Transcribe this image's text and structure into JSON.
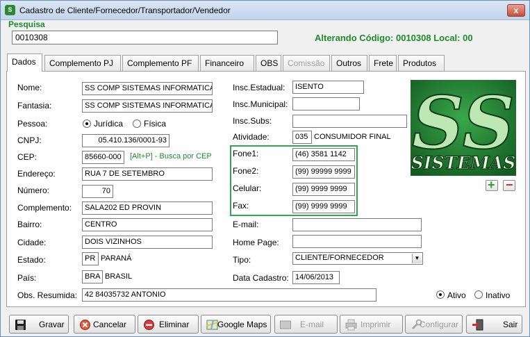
{
  "window": {
    "title": "Cadastro de Cliente/Fornecedor/Transportador/Vendedor",
    "close_glyph": "x"
  },
  "search": {
    "group_label": "Pesquisa",
    "value": "0010308"
  },
  "status": {
    "text": "Alterando Código: 0010308  Local: 00"
  },
  "tabs": [
    {
      "label": "Dados",
      "state": "active"
    },
    {
      "label": "Complemento PJ",
      "state": "normal"
    },
    {
      "label": "Complemento PF",
      "state": "normal"
    },
    {
      "label": "Financeiro",
      "state": "normal"
    },
    {
      "label": "OBS",
      "state": "normal"
    },
    {
      "label": "Comissão",
      "state": "disabled"
    },
    {
      "label": "Outros",
      "state": "normal"
    },
    {
      "label": "Frete",
      "state": "normal"
    },
    {
      "label": "Produtos",
      "state": "normal"
    }
  ],
  "form": {
    "nome": {
      "label": "Nome:",
      "value": "SS COMP SISTEMAS INFORMATICA"
    },
    "fantasia": {
      "label": "Fantasia:",
      "value": "SS COMP SISTEMAS INFORMATICA"
    },
    "pessoa": {
      "label": "Pessoa:",
      "options": [
        "Jurídica",
        "Física"
      ],
      "selected": "Jurídica"
    },
    "cnpj": {
      "label": "CNPJ:",
      "value": "05.410.136/0001-93"
    },
    "cep": {
      "label": "CEP:",
      "value": "85660-000",
      "hint": "[Alt+P]  - Busca por CEP"
    },
    "endereco": {
      "label": "Endereço:",
      "value": "RUA 7 DE SETEMBRO"
    },
    "numero": {
      "label": "Número:",
      "value": "70"
    },
    "complemento": {
      "label": "Complemento:",
      "value": "SALA202 ED PROVIN"
    },
    "bairro": {
      "label": "Bairro:",
      "value": "CENTRO"
    },
    "cidade": {
      "label": "Cidade:",
      "value": "DOIS VIZINHOS"
    },
    "estado": {
      "label": "Estado:",
      "code": "PR",
      "name": "PARANÁ"
    },
    "pais": {
      "label": "País:",
      "code": "BRA",
      "name": "BRASIL"
    },
    "obs_resumida": {
      "label": "Obs. Resumida:",
      "value": "42 84035732 ANTONIO"
    },
    "insc_estadual": {
      "label": "Insc.Estadual:",
      "value": "ISENTO"
    },
    "insc_municipal": {
      "label": "Insc.Municipal:",
      "value": ""
    },
    "insc_subs": {
      "label": "Insc.Subs:",
      "value": ""
    },
    "atividade": {
      "label": "Atividade:",
      "code": "035",
      "name": "CONSUMIDOR FINAL"
    },
    "fone1": {
      "label": "Fone1:",
      "value": "(46) 3581 1142"
    },
    "fone2": {
      "label": "Fone2:",
      "value": "(99) 99999 9999"
    },
    "celular": {
      "label": "Celular:",
      "value": "(99) 9999 9999"
    },
    "fax": {
      "label": "Fax:",
      "value": "(99) 9999 9999"
    },
    "email": {
      "label": "E-mail:",
      "value": ""
    },
    "homepage": {
      "label": "Home Page:",
      "value": ""
    },
    "tipo": {
      "label": "Tipo:",
      "value": "CLIENTE/FORNECEDOR"
    },
    "data_cadastro": {
      "label": "Data Cadastro:",
      "value": "14/06/2013"
    },
    "situacao": {
      "options": [
        "Ativo",
        "Inativo"
      ],
      "selected": "Ativo"
    }
  },
  "logo": {
    "line1": "SS",
    "line2": "SISTEMAS"
  },
  "photo_buttons": {
    "add_glyph": "+",
    "remove_glyph": "−"
  },
  "buttons": {
    "gravar": "Gravar",
    "cancelar": "Cancelar",
    "eliminar": "Eliminar",
    "google_maps": "Google Maps",
    "email": "E-mail",
    "imprimir": "Imprimir",
    "configurar": "Configurar",
    "sair": "Sair"
  },
  "colors": {
    "accent_green": "#1f8a2c",
    "phone_box_border": "#2faa4a",
    "logo_green": "#2b8f3a"
  }
}
